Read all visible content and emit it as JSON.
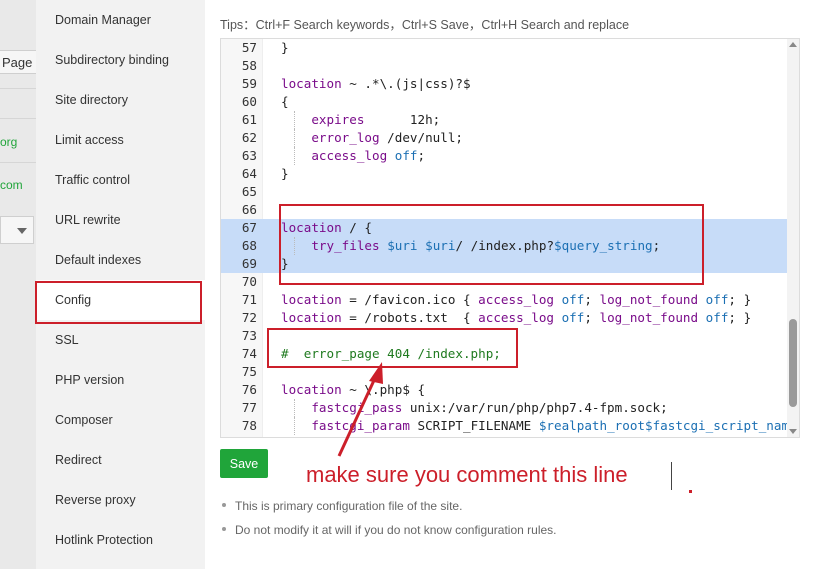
{
  "background": {
    "page_label": "Page",
    "org_text": "org",
    "com_text": "com"
  },
  "sidebar": {
    "items": [
      {
        "label": "Domain Manager"
      },
      {
        "label": "Subdirectory binding"
      },
      {
        "label": "Site directory"
      },
      {
        "label": "Limit access"
      },
      {
        "label": "Traffic control"
      },
      {
        "label": "URL rewrite"
      },
      {
        "label": "Default indexes"
      },
      {
        "label": "Config"
      },
      {
        "label": "SSL"
      },
      {
        "label": "PHP version"
      },
      {
        "label": "Composer"
      },
      {
        "label": "Redirect"
      },
      {
        "label": "Reverse proxy"
      },
      {
        "label": "Hotlink Protection"
      }
    ],
    "active": "Config"
  },
  "main": {
    "tips": "Tips：Ctrl+F Search keywords，Ctrl+S Save，Ctrl+H Search and replace",
    "save_label": "Save",
    "notes": [
      "This is primary configuration file of the site.",
      "Do not modify it at will if you do not know configuration rules."
    ]
  },
  "editor": {
    "lines": [
      {
        "n": "57",
        "code": "}"
      },
      {
        "n": "58",
        "code": ""
      },
      {
        "n": "59",
        "code": "location ~ .*\\.(js|css)?$"
      },
      {
        "n": "60",
        "code": "{"
      },
      {
        "n": "61",
        "code": "    expires      12h;"
      },
      {
        "n": "62",
        "code": "    error_log /dev/null;"
      },
      {
        "n": "63",
        "code": "    access_log off;"
      },
      {
        "n": "64",
        "code": "}"
      },
      {
        "n": "65",
        "code": ""
      },
      {
        "n": "66",
        "code": ""
      },
      {
        "n": "67",
        "code": "location / {"
      },
      {
        "n": "68",
        "code": "    try_files $uri $uri/ /index.php?$query_string;"
      },
      {
        "n": "69",
        "code": "}"
      },
      {
        "n": "70",
        "code": ""
      },
      {
        "n": "71",
        "code": "location = /favicon.ico { access_log off; log_not_found off; }"
      },
      {
        "n": "72",
        "code": "location = /robots.txt  { access_log off; log_not_found off; }"
      },
      {
        "n": "73",
        "code": ""
      },
      {
        "n": "74",
        "code": "#  error_page 404 /index.php;"
      },
      {
        "n": "75",
        "code": ""
      },
      {
        "n": "76",
        "code": "location ~ \\.php$ {"
      },
      {
        "n": "77",
        "code": "    fastcgi_pass unix:/var/run/php/php7.4-fpm.sock;"
      },
      {
        "n": "78",
        "code": "    fastcgi_param SCRIPT_FILENAME $realpath_root$fastcgi_script_name"
      }
    ]
  },
  "annotation": {
    "text": "make sure you comment this line",
    "color": "#cc1f2a"
  },
  "colors": {
    "accent": "#20a53a",
    "selection": "#c7dcf8"
  }
}
